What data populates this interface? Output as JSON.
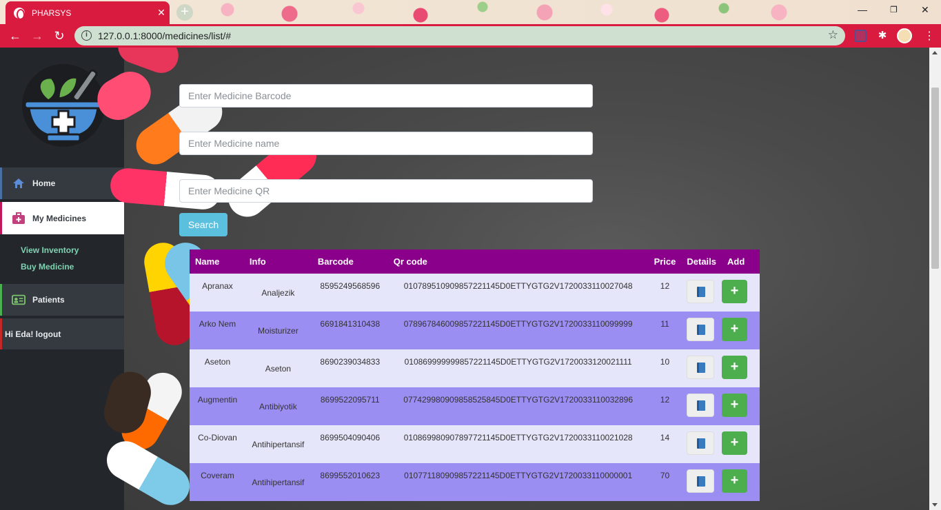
{
  "browser": {
    "tab_title": "PHARSYS",
    "tab_close": "✕",
    "new_tab": "+",
    "url": "127.0.0.1:8000/medicines/list/#"
  },
  "sidebar": {
    "home": "Home",
    "my_medicines": "My Medicines",
    "view_inventory": "View Inventory",
    "buy_medicine": "Buy Medicine",
    "patients": "Patients",
    "logout": "Hi Eda! logout"
  },
  "search": {
    "barcode_placeholder": "Enter Medicine Barcode",
    "name_placeholder": "Enter Medicine name",
    "qr_placeholder": "Enter Medicine QR",
    "button": "Search"
  },
  "table": {
    "headers": [
      "Name",
      "Info",
      "Barcode",
      "Qr code",
      "Price",
      "Details",
      "Add"
    ],
    "add_label": "+",
    "rows": [
      {
        "name": "Apranax",
        "info": "Analjezik",
        "barcode": "8595249568596",
        "qr": "01078951090985722114 5D0ETTYGTG2V1720033110027048",
        "price": "12"
      },
      {
        "name": "Arko Nem",
        "info": "Moisturizer",
        "barcode": "6691841310438",
        "qr": "07896784600985722114 5D0ETTYGTG2V1720033110099999",
        "price": "11"
      },
      {
        "name": "Aseton",
        "info": "Aseton",
        "barcode": "8690239034833",
        "qr": "01086999999985722114 5D0ETTYGTG2V1720033120021111",
        "price": "10"
      },
      {
        "name": "Augmentin",
        "info": "Antibiyotik",
        "barcode": "8699522095711",
        "qr": "07742998090985852584 5D0ETTYGTG2V1720033110032896",
        "price": "12"
      },
      {
        "name": "Co-Diovan",
        "info": "Antihipertansif",
        "barcode": "8699504090406",
        "qr": "01086998090789772114 5D0ETTYGTG2V1720033110021028",
        "price": "14"
      },
      {
        "name": "Coveram",
        "info": "Antihipertansif",
        "barcode": "8699552010623",
        "qr": "01077118090985722114 5D0ETTYGTG2V1720033110000001",
        "price": "70"
      }
    ]
  }
}
